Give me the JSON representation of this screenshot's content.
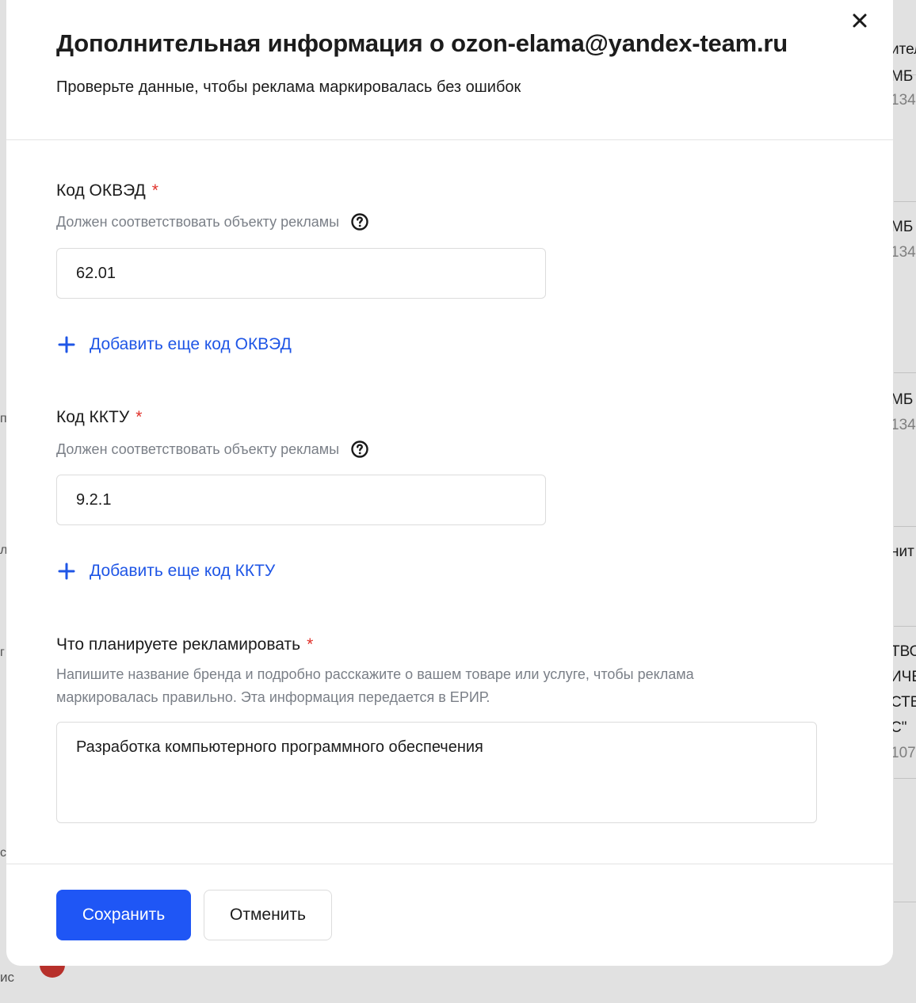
{
  "background": {
    "left_fragments": [
      "п",
      "л",
      "г",
      "с"
    ],
    "bottom_fragment": "ис",
    "right_column": [
      {
        "text": "ител",
        "muted": false
      },
      {
        "text": "МБ",
        "muted": false
      },
      {
        "text": "134",
        "muted": true
      },
      {
        "text": "МБ",
        "muted": false
      },
      {
        "text": "134",
        "muted": true
      },
      {
        "text": "МБ",
        "muted": false
      },
      {
        "text": "134",
        "muted": true
      },
      {
        "text": "нит",
        "muted": false
      },
      {
        "text": "ТВО",
        "muted": false
      },
      {
        "text": "ИЧЕ",
        "muted": false
      },
      {
        "text": "СТВ",
        "muted": false
      },
      {
        "text": "С\"",
        "muted": false
      },
      {
        "text": "107",
        "muted": true
      }
    ]
  },
  "modal": {
    "title": "Дополнительная информация о ozon-elama@yandex-team.ru",
    "subtitle": "Проверьте данные, чтобы реклама маркировалась без ошибок",
    "close_icon": "close-icon"
  },
  "okved": {
    "label": "Код ОКВЭД",
    "required_mark": "*",
    "hint": "Должен соответствовать объекту рекламы",
    "value": "62.01",
    "add_link": "Добавить еще код ОКВЭД"
  },
  "kktu": {
    "label": "Код ККТУ",
    "required_mark": "*",
    "hint": "Должен соответствовать объекту рекламы",
    "value": "9.2.1",
    "add_link": "Добавить еще код ККТУ"
  },
  "product": {
    "label": "Что планируете рекламировать",
    "required_mark": "*",
    "hint": "Напишите название бренда и подробно расскажите о вашем товаре или услуге, чтобы реклама маркировалась правильно. Эта информация передается в ЕРИР.",
    "value": "Разработка компьютерного программного обеспечения"
  },
  "footer": {
    "save_label": "Сохранить",
    "cancel_label": "Отменить"
  },
  "colors": {
    "primary": "#1f56f5",
    "link": "#1f56e6",
    "required": "#e0312a",
    "hint": "#7a7f87"
  }
}
